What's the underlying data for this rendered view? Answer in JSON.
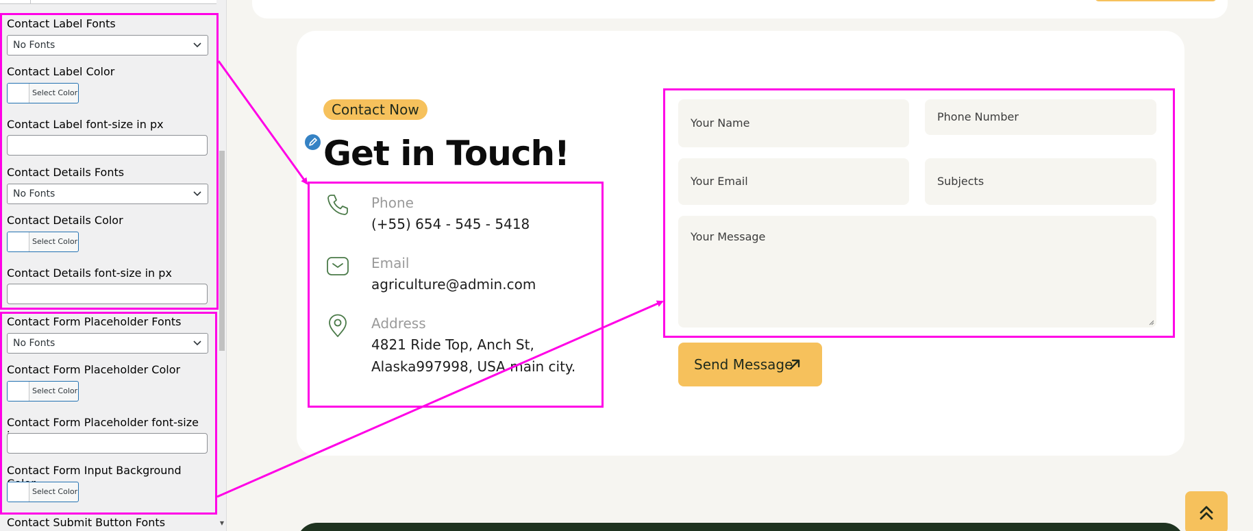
{
  "customizer": {
    "controls": [
      {
        "label": "Contact Label Fonts",
        "type": "select",
        "value": "No Fonts"
      },
      {
        "label": "Contact Label Color",
        "type": "color",
        "button": "Select Color"
      },
      {
        "label": "Contact Label font-size in px",
        "type": "text",
        "value": ""
      },
      {
        "label": "Contact Details Fonts",
        "type": "select",
        "value": "No Fonts"
      },
      {
        "label": "Contact Details Color",
        "type": "color",
        "button": "Select Color"
      },
      {
        "label": "Contact Details font-size in px",
        "type": "text",
        "value": ""
      },
      {
        "label": "Contact Form Placeholder Fonts",
        "type": "select",
        "value": "No Fonts"
      },
      {
        "label": "Contact Form Placeholder Color",
        "type": "color",
        "button": "Select Color"
      },
      {
        "label": "Contact Form Placeholder font-size in px",
        "type": "text",
        "value": ""
      },
      {
        "label": "Contact Form Input Background Color",
        "type": "color",
        "button": "Select Color"
      },
      {
        "label": "Contact Submit Button Fonts",
        "type": "label"
      }
    ]
  },
  "contact": {
    "badge": "Contact Now",
    "heading": "Get in Touch!",
    "phone": {
      "label": "Phone",
      "value": "(+55) 654 - 545 - 5418",
      "icon": "phone-icon"
    },
    "email": {
      "label": "Email",
      "value": "agriculture@admin.com",
      "icon": "envelope-icon"
    },
    "address": {
      "label": "Address",
      "line1": "4821 Ride Top, Anch St,",
      "line2": "Alaska997998, USA main city.",
      "icon": "map-pin-icon"
    }
  },
  "form": {
    "name_placeholder": "Your Name",
    "phone_placeholder": "Phone Number",
    "email_placeholder": "Your Email",
    "subject_placeholder": "Subjects",
    "message_placeholder": "Your Message",
    "submit_label": "Send Message"
  },
  "colors": {
    "accent": "#f6c15c",
    "annotation": "#ff00e6",
    "icon_green": "#4a7a48",
    "field_bg": "#f6f5f0"
  }
}
